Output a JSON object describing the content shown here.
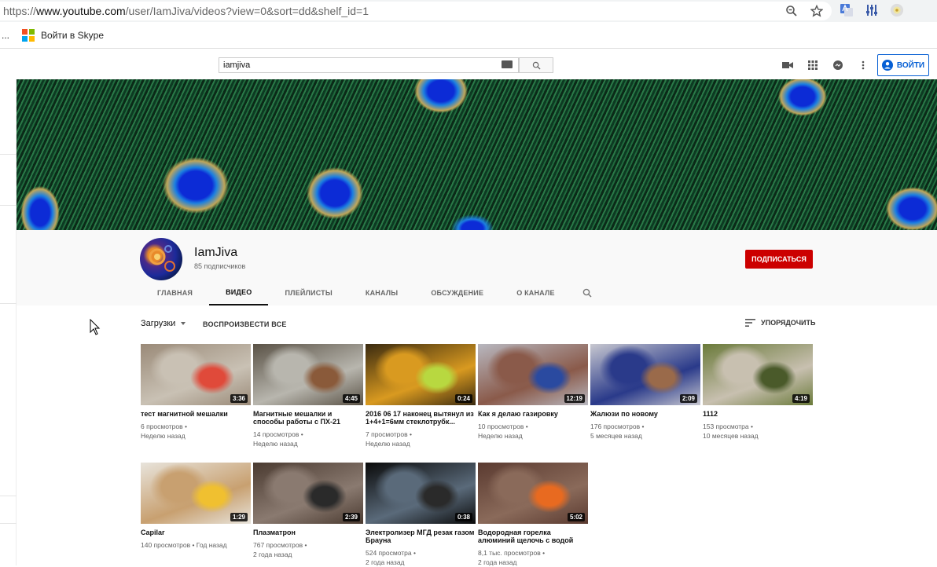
{
  "browser": {
    "url_prefix": "https://",
    "url_host": "www.youtube.com",
    "url_path": "/user/IamJiva/videos?view=0&sort=dd&shelf_id=1",
    "bookmark_overflow": "...",
    "bookmark_label": "Войти в Skype"
  },
  "masthead": {
    "search_value": "iamjiva",
    "signin_label": "ВОЙТИ"
  },
  "channel": {
    "name": "IamJiva",
    "subscribers": "85 подписчиков",
    "subscribe_label": "ПОДПИСАТЬСЯ",
    "tabs": [
      {
        "label": "ГЛАВНАЯ"
      },
      {
        "label": "ВИДЕО"
      },
      {
        "label": "ПЛЕЙЛИСТЫ"
      },
      {
        "label": "КАНАЛЫ"
      },
      {
        "label": "ОБСУЖДЕНИЕ"
      },
      {
        "label": "О КАНАЛЕ"
      }
    ]
  },
  "content": {
    "filter_label": "Загрузки",
    "play_all_label": "ВОСПРОИЗВЕСТИ ВСЕ",
    "sort_label": "УПОРЯДОЧИТЬ"
  },
  "videos": [
    {
      "title": "тест магнитной мешалки",
      "views": "6 просмотров •",
      "age": "Неделю назад",
      "duration": "3:36",
      "colors": [
        "#9a8a78",
        "#c9c1b4",
        "#e04a3a"
      ]
    },
    {
      "title": "Магнитные мешалки и способы работы с ПХ-21",
      "views": "14 просмотров •",
      "age": "Неделю назад",
      "duration": "4:45",
      "colors": [
        "#5a5246",
        "#b8b6ae",
        "#8a5a3a"
      ]
    },
    {
      "title": "2016 06 17 наконец вытянул из 1+4+1=6мм стеклотрубк...",
      "views": "7 просмотров •",
      "age": "Неделю назад",
      "duration": "0:24",
      "colors": [
        "#3a2a10",
        "#d99a20",
        "#b8d840"
      ]
    },
    {
      "title": "Как я делаю газировку",
      "views": "10 просмотров •",
      "age": "Неделю назад",
      "duration": "12:19",
      "colors": [
        "#b8b8c0",
        "#8a5a4a",
        "#2a4aa0"
      ]
    },
    {
      "title": "Жалюзи по новому",
      "views": "176 просмотров •",
      "age": "5 месяцев назад",
      "duration": "2:09",
      "colors": [
        "#c8c8d0",
        "#2a3a8a",
        "#9a6a4a"
      ]
    },
    {
      "title": "1112",
      "views": "153 просмотра •",
      "age": "10 месяцев назад",
      "duration": "4:19",
      "colors": [
        "#6a7a3a",
        "#c8c0b0",
        "#4a5a2a"
      ]
    },
    {
      "title": "Capilar",
      "views": "140 просмотров • Год назад",
      "age": "",
      "duration": "1:29",
      "colors": [
        "#e8e4dc",
        "#c8a070",
        "#f0c030"
      ]
    },
    {
      "title": "Плазматрон",
      "views": "767 просмотров •",
      "age": "2 года назад",
      "duration": "2:39",
      "colors": [
        "#4a3a30",
        "#8a7a70",
        "#2a2a2a"
      ]
    },
    {
      "title": "Электролизер МГД резак газом Брауна",
      "views": "524 просмотра •",
      "age": "2 года назад",
      "duration": "0:38",
      "colors": [
        "#0a0a0a",
        "#5a6a7a",
        "#2a2a2a"
      ]
    },
    {
      "title": "Водородная горелка алюминий щелочь с водой",
      "views": "8,1 тыс. просмотров •",
      "age": "2 года назад",
      "duration": "5:02",
      "colors": [
        "#5a3a30",
        "#8a6a5a",
        "#e86a20"
      ]
    }
  ]
}
